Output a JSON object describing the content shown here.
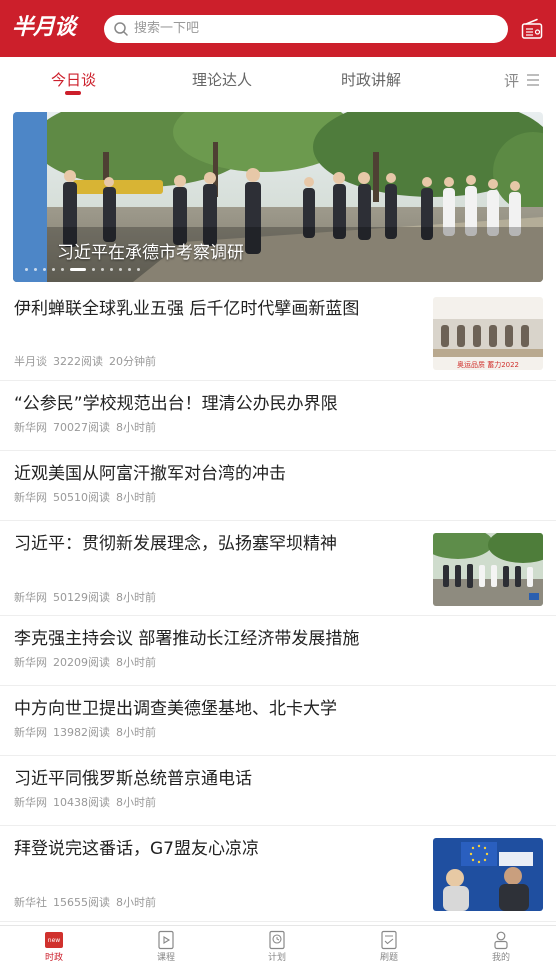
{
  "header": {
    "logo_text": "半月谈",
    "search_placeholder": "搜索一下吧",
    "brand_color": "#cc1f2b"
  },
  "tabs": [
    {
      "label": "今日谈",
      "active": true
    },
    {
      "label": "理论达人",
      "active": false
    },
    {
      "label": "时政讲解",
      "active": false
    },
    {
      "label": "评",
      "active": false
    }
  ],
  "banner": {
    "caption": "习近平在承德市考察调研",
    "slide_count": 12,
    "active_slide": 6
  },
  "news": [
    {
      "title": "伊利蝉联全球乳业五强 后千亿时代擘画新蓝图",
      "source": "半月谈",
      "reads": "3222阅读",
      "time": "20分钟前",
      "thumb_text": "奥运品质 蓄力2022"
    },
    {
      "title": "“公参民”学校规范出台！理清公办民办界限",
      "source": "新华网",
      "reads": "70027阅读",
      "time": "8小时前"
    },
    {
      "title": "近观美国从阿富汗撤军对台湾的冲击",
      "source": "新华网",
      "reads": "50510阅读",
      "time": "8小时前"
    },
    {
      "title": "习近平：贯彻新发展理念，弘扬塞罕坝精神",
      "source": "新华网",
      "reads": "50129阅读",
      "time": "8小时前"
    },
    {
      "title": "李克强主持会议 部署推动长江经济带发展措施",
      "source": "新华网",
      "reads": "20209阅读",
      "time": "8小时前"
    },
    {
      "title": "中方向世卫提出调查美德堡基地、北卡大学",
      "source": "新华网",
      "reads": "13982阅读",
      "time": "8小时前"
    },
    {
      "title": "习近平同俄罗斯总统普京通电话",
      "source": "新华网",
      "reads": "10438阅读",
      "time": "8小时前"
    },
    {
      "title": "拜登说完这番话，G7盟友心凉凉",
      "source": "新华社",
      "reads": "15655阅读",
      "time": "8小时前"
    }
  ],
  "bottom_nav": [
    {
      "label": "时政",
      "icon": "news-icon",
      "active": true
    },
    {
      "label": "课程",
      "icon": "course-icon",
      "active": false
    },
    {
      "label": "计划",
      "icon": "plan-icon",
      "active": false
    },
    {
      "label": "刷题",
      "icon": "quiz-icon",
      "active": false
    },
    {
      "label": "我的",
      "icon": "profile-icon",
      "active": false
    }
  ]
}
